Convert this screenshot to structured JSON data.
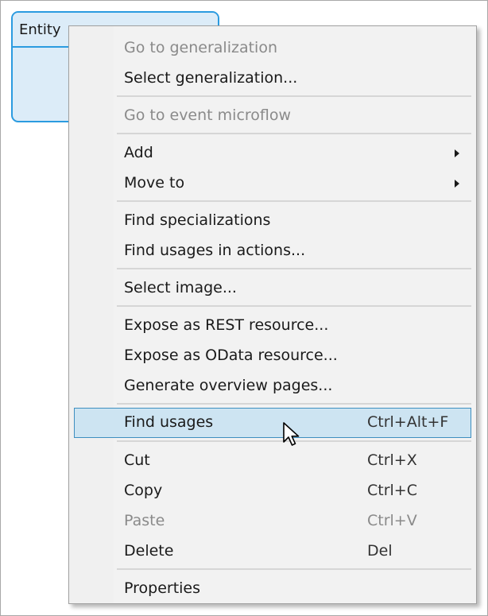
{
  "entity": {
    "title": "Entity",
    "border_color": "#2b9be0",
    "fill_color": "#dcecf8"
  },
  "menu": {
    "highlight_color": "#cde4f2",
    "items": [
      {
        "label": "Go to generalization",
        "shortcut": "",
        "disabled": true,
        "submenu": false
      },
      {
        "label": "Select generalization...",
        "shortcut": "",
        "disabled": false,
        "submenu": false
      },
      {
        "label": "Go to event microflow",
        "shortcut": "",
        "disabled": true,
        "submenu": false
      },
      {
        "label": "Add",
        "shortcut": "",
        "disabled": false,
        "submenu": true,
        "icon": "chevron-right-icon"
      },
      {
        "label": "Move to",
        "shortcut": "",
        "disabled": false,
        "submenu": true,
        "icon": "chevron-right-icon"
      },
      {
        "label": "Find specializations",
        "shortcut": "",
        "disabled": false,
        "submenu": false
      },
      {
        "label": "Find usages in actions...",
        "shortcut": "",
        "disabled": false,
        "submenu": false
      },
      {
        "label": "Select image...",
        "shortcut": "",
        "disabled": false,
        "submenu": false
      },
      {
        "label": "Expose as REST resource...",
        "shortcut": "",
        "disabled": false,
        "submenu": false
      },
      {
        "label": "Expose as OData resource...",
        "shortcut": "",
        "disabled": false,
        "submenu": false
      },
      {
        "label": "Generate overview pages...",
        "shortcut": "",
        "disabled": false,
        "submenu": false
      },
      {
        "label": "Find usages",
        "shortcut": "Ctrl+Alt+F",
        "disabled": false,
        "submenu": false,
        "highlighted": true
      },
      {
        "label": "Cut",
        "shortcut": "Ctrl+X",
        "disabled": false,
        "submenu": false
      },
      {
        "label": "Copy",
        "shortcut": "Ctrl+C",
        "disabled": false,
        "submenu": false
      },
      {
        "label": "Paste",
        "shortcut": "Ctrl+V",
        "disabled": true,
        "submenu": false
      },
      {
        "label": "Delete",
        "shortcut": "Del",
        "disabled": false,
        "submenu": false
      },
      {
        "label": "Properties",
        "shortcut": "",
        "disabled": false,
        "submenu": false
      }
    ]
  },
  "cursor": {
    "icon": "mouse-pointer-icon"
  }
}
